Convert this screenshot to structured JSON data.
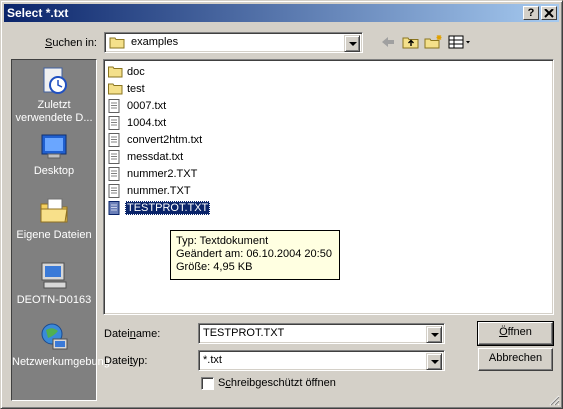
{
  "window": {
    "title": "Select *.txt",
    "help_glyph": "?",
    "close_glyph": "X"
  },
  "lookin": {
    "label_pre": "",
    "label_hotkey": "S",
    "label_post": "uchen in:",
    "value": "examples"
  },
  "toolbar": {
    "icons": [
      "back-arrow-icon",
      "up-folder-icon",
      "new-folder-icon",
      "view-menu-icon"
    ]
  },
  "places": [
    {
      "label": "Zuletzt verwendete D...",
      "icon": "recent-documents-icon"
    },
    {
      "label": "Desktop",
      "icon": "desktop-icon"
    },
    {
      "label": "Eigene Dateien",
      "icon": "my-documents-icon"
    },
    {
      "label": "DEOTN-D0163",
      "icon": "my-computer-icon"
    },
    {
      "label": "Netzwerkumgebung",
      "icon": "network-places-icon"
    }
  ],
  "files": [
    {
      "name": "doc",
      "type": "folder"
    },
    {
      "name": "test",
      "type": "folder"
    },
    {
      "name": "0007.txt",
      "type": "text"
    },
    {
      "name": "1004.txt",
      "type": "text"
    },
    {
      "name": "convert2htm.txt",
      "type": "text"
    },
    {
      "name": "messdat.txt",
      "type": "text"
    },
    {
      "name": "nummer2.TXT",
      "type": "text"
    },
    {
      "name": "nummer.TXT",
      "type": "text"
    },
    {
      "name": "TESTPROT.TXT",
      "type": "text",
      "selected": true
    }
  ],
  "tooltip": {
    "line1": "Typ: Textdokument",
    "line2": "Geändert am: 06.10.2004 20:50",
    "line3": "Größe: 4,95 KB"
  },
  "filename": {
    "label_pre": "Datei",
    "label_hotkey": "n",
    "label_post": "ame:",
    "value": "TESTPROT.TXT"
  },
  "filetype": {
    "label_pre": "Datei",
    "label_hotkey": "t",
    "label_post": "yp:",
    "value": "*.txt"
  },
  "readonly": {
    "label_pre": "S",
    "label_hotkey": "c",
    "label_post": "hreibgeschützt öffnen",
    "checked": false
  },
  "buttons": {
    "open_hotkey": "Ö",
    "open_rest": "ffnen",
    "cancel": "Abbrechen"
  },
  "colors": {
    "titlebar_start": "#0a246a",
    "titlebar_end": "#a6caf0",
    "selection": "#0a246a",
    "tooltip_bg": "#ffffe1",
    "places_bg": "#808080"
  }
}
